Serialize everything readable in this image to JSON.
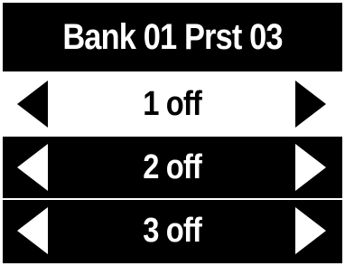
{
  "header": {
    "title": "Bank 01 Prst 03"
  },
  "rows": [
    {
      "label": "1 off",
      "selected": true,
      "left_icon": "triangle-left-icon",
      "right_icon": "triangle-right-icon"
    },
    {
      "label": "2 off",
      "selected": false,
      "left_icon": "triangle-left-icon",
      "right_icon": "triangle-right-icon"
    },
    {
      "label": "3 off",
      "selected": false,
      "left_icon": "triangle-left-icon",
      "right_icon": "triangle-right-icon"
    }
  ],
  "colors": {
    "background": "#000000",
    "foreground": "#ffffff",
    "selected_background": "#ffffff",
    "selected_foreground": "#000000"
  }
}
